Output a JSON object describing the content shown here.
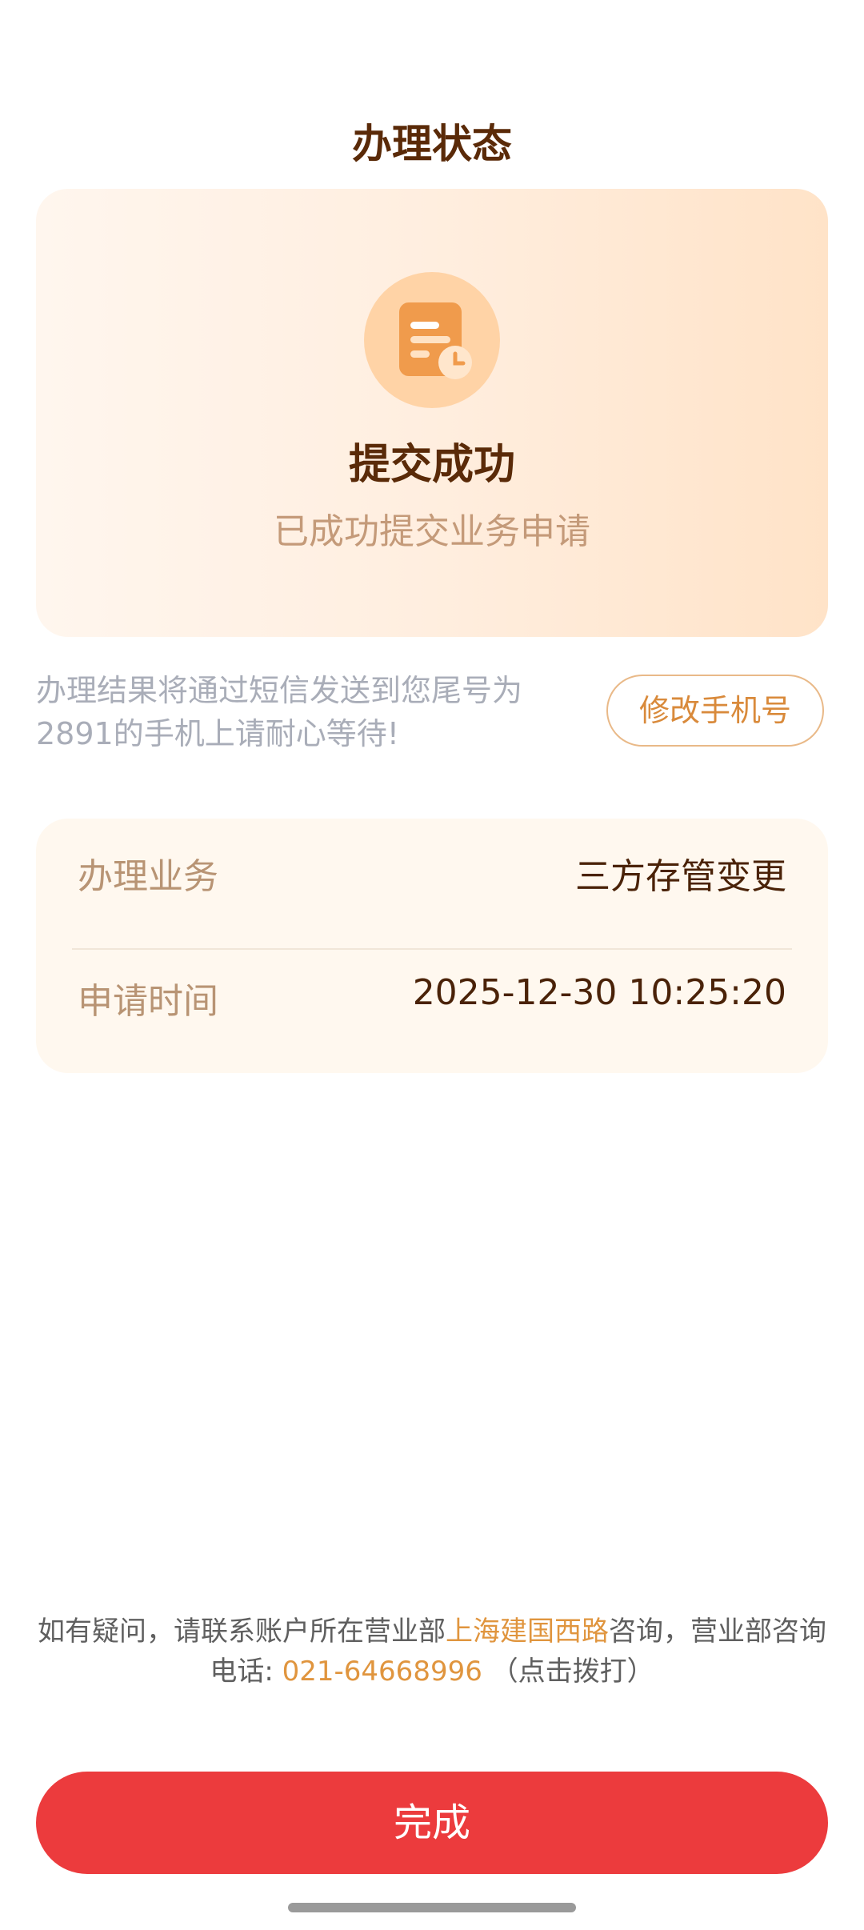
{
  "header": {
    "title": "办理状态"
  },
  "status_card": {
    "icon": "document-clock-icon",
    "title": "提交成功",
    "subtitle": "已成功提交业务申请"
  },
  "notice": {
    "text_line1": "办理结果将通过短信发送到您尾号为",
    "text_line2": "2891的手机上请耐心等待!",
    "change_phone_label": "修改手机号"
  },
  "details": {
    "rows": [
      {
        "label": "办理业务",
        "value": "三方存管变更"
      },
      {
        "label": "申请时间",
        "value": "2025-12-30 10:25:20"
      }
    ]
  },
  "contact": {
    "prefix": "如有疑问，请联系账户所在营业部",
    "branch_link": "上海建国西路",
    "middle": "咨询，营业部咨询电话:",
    "phone_link": "021-64668996",
    "suffix": "（点击拨打）"
  },
  "footer": {
    "done_label": "完成"
  },
  "colors": {
    "accent_orange": "#e0953e",
    "primary_red": "#ec3b3d",
    "title_brown": "#5a2a08"
  }
}
